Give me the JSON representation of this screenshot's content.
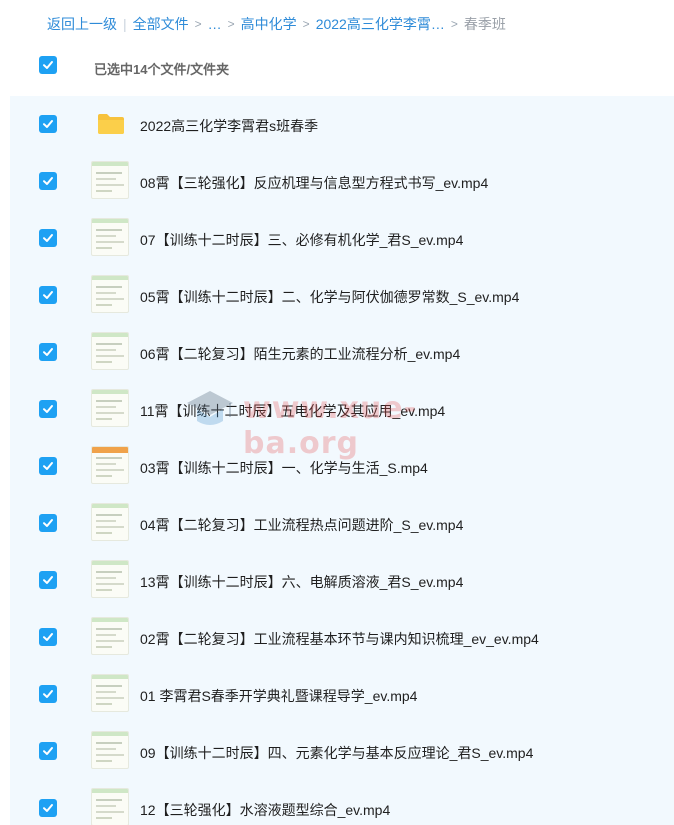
{
  "breadcrumb": {
    "back": "返回上一级",
    "all_files": "全部文件",
    "ellipsis": "…",
    "level1": "高中化学",
    "level2": "2022高三化学李霄…",
    "current": "春季班"
  },
  "header": {
    "selected_text": "已选中14个文件/文件夹"
  },
  "colors": {
    "accent": "#1ea1f3",
    "link": "#2e8bd8",
    "row_bg": "#f2f9fe",
    "folder": "#f7c23c"
  },
  "files": [
    {
      "name": "2022高三化学李霄君s班春季",
      "icon": "folder-icon"
    },
    {
      "name": "08霄【三轮强化】反应机理与信息型方程式书写_ev.mp4",
      "icon": "video-thumbnail"
    },
    {
      "name": "07【训练十二时辰】三、必修有机化学_君S_ev.mp4",
      "icon": "video-thumbnail"
    },
    {
      "name": "05霄【训练十二时辰】二、化学与阿伏伽德罗常数_S_ev.mp4",
      "icon": "video-thumbnail"
    },
    {
      "name": "06霄【二轮复习】陌生元素的工业流程分析_ev.mp4",
      "icon": "video-thumbnail"
    },
    {
      "name": "11霄【训练十二时辰】五电化学及其应用_ev.mp4",
      "icon": "video-thumbnail"
    },
    {
      "name": "03霄【训练十二时辰】一、化学与生活_S.mp4",
      "icon": "video-thumbnail-orange"
    },
    {
      "name": "04霄【二轮复习】工业流程热点问题进阶_S_ev.mp4",
      "icon": "video-thumbnail"
    },
    {
      "name": "13霄【训练十二时辰】六、电解质溶液_君S_ev.mp4",
      "icon": "video-thumbnail"
    },
    {
      "name": "02霄【二轮复习】工业流程基本环节与课内知识梳理_ev_ev.mp4",
      "icon": "video-thumbnail"
    },
    {
      "name": "01 李霄君S春季开学典礼暨课程导学_ev.mp4",
      "icon": "video-thumbnail"
    },
    {
      "name": "09【训练十二时辰】四、元素化学与基本反应理论_君S_ev.mp4",
      "icon": "video-thumbnail"
    },
    {
      "name": "12【三轮强化】水溶液题型综合_ev.mp4",
      "icon": "video-thumbnail"
    }
  ],
  "watermark": "www.xue-ba.org"
}
